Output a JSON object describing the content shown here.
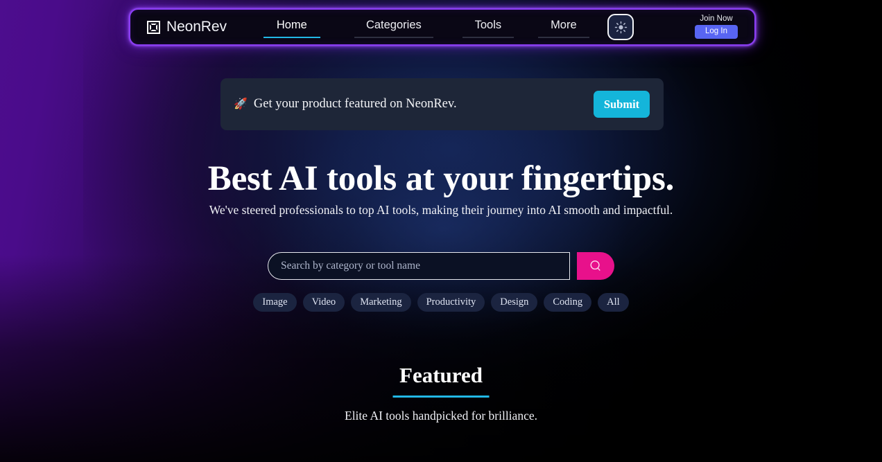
{
  "brand": {
    "name": "NeonRev",
    "logo_icon": "square-outline-logo-icon"
  },
  "navbar": {
    "links": [
      {
        "label": "Home",
        "active": true
      },
      {
        "label": "Categories",
        "active": false
      },
      {
        "label": "Tools",
        "active": false
      },
      {
        "label": "More",
        "active": false
      }
    ],
    "theme_toggle_icon": "sun-icon",
    "join_now_label": "Join Now",
    "login_label": "Log In",
    "colors": {
      "border_glow": "#8b3df5",
      "active_underline": "#22b8e6",
      "login_button": "#5865f2"
    }
  },
  "promo": {
    "emoji": "🚀",
    "text": "Get your product featured on NeonRev.",
    "submit_label": "Submit",
    "submit_color": "#14b5da",
    "background": "#1e2638"
  },
  "hero": {
    "title": "Best AI tools at your fingertips.",
    "subtitle": "We've steered professionals to top AI tools, making their journey into AI smooth and impactful."
  },
  "search": {
    "placeholder": "Search by category or tool name",
    "value": "",
    "button_icon": "search-icon",
    "button_color": "#e8118b"
  },
  "categories": [
    {
      "label": "Image"
    },
    {
      "label": "Video"
    },
    {
      "label": "Marketing"
    },
    {
      "label": "Productivity"
    },
    {
      "label": "Design"
    },
    {
      "label": "Coding"
    },
    {
      "label": "All"
    }
  ],
  "featured": {
    "title": "Featured",
    "subtitle": "Elite AI tools handpicked for brilliance.",
    "rule_color": "#22b8e6"
  }
}
